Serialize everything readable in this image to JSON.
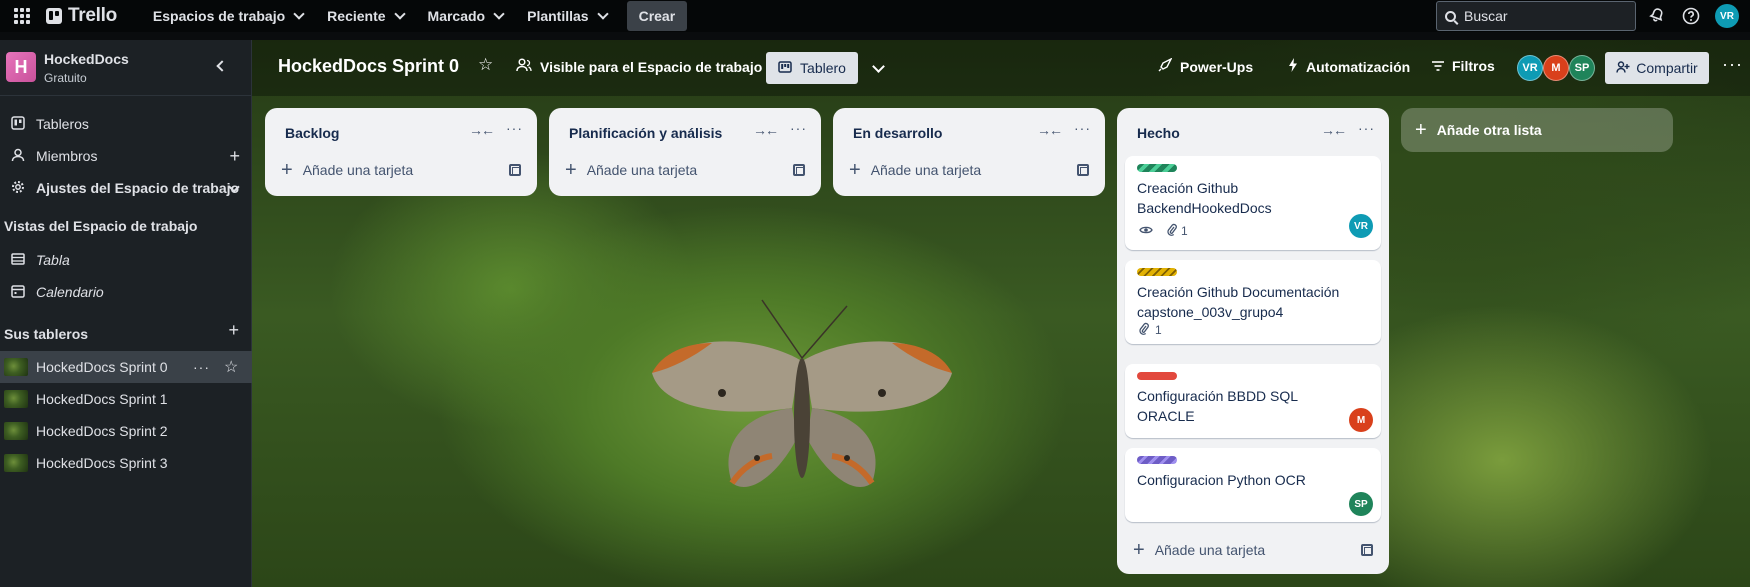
{
  "topbar": {
    "logo": "Trello",
    "nav": [
      "Espacios de trabajo",
      "Reciente",
      "Marcado",
      "Plantillas"
    ],
    "create": "Crear",
    "search_placeholder": "Buscar",
    "avatar": "VR"
  },
  "sidebar": {
    "workspace_initial": "H",
    "workspace_name": "HockedDocs",
    "workspace_plan": "Gratuito",
    "items": [
      {
        "label": "Tableros",
        "icon": "trello-icon"
      },
      {
        "label": "Miembros",
        "icon": "person-icon"
      },
      {
        "label": "Ajustes del Espacio de trabajo",
        "icon": "gear-icon"
      }
    ],
    "views_heading": "Vistas del Espacio de trabajo",
    "views": [
      {
        "label": "Tabla",
        "icon": "table-icon"
      },
      {
        "label": "Calendario",
        "icon": "calendar-icon"
      }
    ],
    "boards_heading": "Sus tableros",
    "boards": [
      "HockedDocs Sprint 0",
      "HockedDocs Sprint 1",
      "HockedDocs Sprint 2",
      "HockedDocs Sprint 3"
    ],
    "active_board_index": 0
  },
  "board": {
    "title": "HockedDocs Sprint 0",
    "visibility": "Visible para el Espacio de trabajo",
    "view": "Tablero",
    "powerups": "Power-Ups",
    "automation": "Automatización",
    "filters": "Filtros",
    "members": [
      {
        "initials": "VR",
        "color": "#0e9bb4"
      },
      {
        "initials": "M",
        "color": "#d9401b"
      },
      {
        "initials": "SP",
        "color": "#1f845a"
      }
    ],
    "share": "Compartir",
    "add_list": "Añade otra lista",
    "add_card": "Añade una tarjeta",
    "lists": [
      {
        "title": "Backlog",
        "cards": []
      },
      {
        "title": "Planificación y análisis",
        "cards": []
      },
      {
        "title": "En desarrollo",
        "cards": []
      },
      {
        "title": "Hecho",
        "cards": [
          {
            "label_color": "#1f845a",
            "label_stripes": true,
            "title_line1": "Creación Github",
            "title_line2": "BackendHookedDocs",
            "watch": true,
            "attachments": "1",
            "member": "VR",
            "member_color": "#0e9bb4"
          },
          {
            "label_color": "#e2b203",
            "label_stripes": true,
            "title_line1": "Creación Github Documentación",
            "title_line2": "capstone_003v_grupo4",
            "watch": false,
            "attachments": "1",
            "member": "",
            "member_color": ""
          },
          {
            "label_color": "#e2483d",
            "label_stripes": false,
            "title_line1": "Configuración BBDD SQL ORACLE",
            "title_line2": "",
            "watch": false,
            "attachments": "",
            "member": "M",
            "member_color": "#d9401b"
          },
          {
            "label_color": "#6e5dc6",
            "label_stripes": true,
            "title_line1": "Configuracion Python OCR",
            "title_line2": "",
            "watch": false,
            "attachments": "",
            "member": "SP",
            "member_color": "#1f845a"
          }
        ]
      }
    ]
  }
}
